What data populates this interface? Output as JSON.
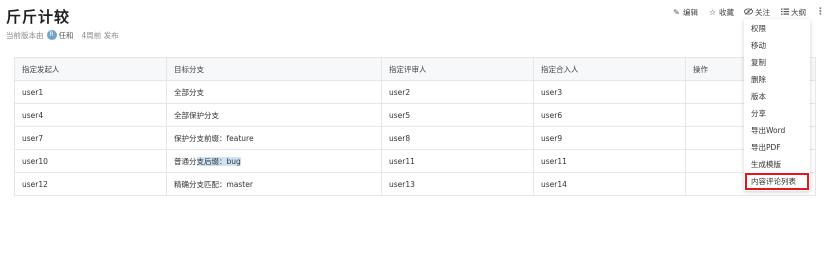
{
  "page": {
    "title": "斤斤计较",
    "meta": {
      "version_label": "当前版本由",
      "author_initial": "R",
      "author": "任和",
      "time": "4周前 发布"
    }
  },
  "toolbar": {
    "edit": "编辑",
    "favorite": "收藏",
    "follow": "关注",
    "outline": "大纲",
    "more": "⋮"
  },
  "table": {
    "headers": [
      "指定发起人",
      "目标分支",
      "指定评审人",
      "指定合入人",
      "操作"
    ],
    "rows": [
      [
        "user1",
        "全部分支",
        "user2",
        "user3",
        ""
      ],
      [
        "user4",
        "全部保护分支",
        "user5",
        "user6",
        ""
      ],
      [
        "user7",
        "保护分支前缀：feature",
        "user8",
        "user9",
        ""
      ],
      [
        "user10",
        "普通分支后缀：bug",
        "user11",
        "user11",
        ""
      ],
      [
        "user12",
        "精确分支匹配：master",
        "user13",
        "user14",
        ""
      ]
    ],
    "highlight": {
      "row": 3,
      "prefix": "普通分",
      "selected": "支后缀：bug"
    }
  },
  "menu": {
    "items": [
      "权限",
      "移动",
      "复制",
      "删除",
      "版本",
      "分享",
      "导出Word",
      "导出PDF",
      "生成模版",
      "内容评论列表"
    ],
    "selected_index": 9,
    "selected_border_color": "#e0191e"
  }
}
